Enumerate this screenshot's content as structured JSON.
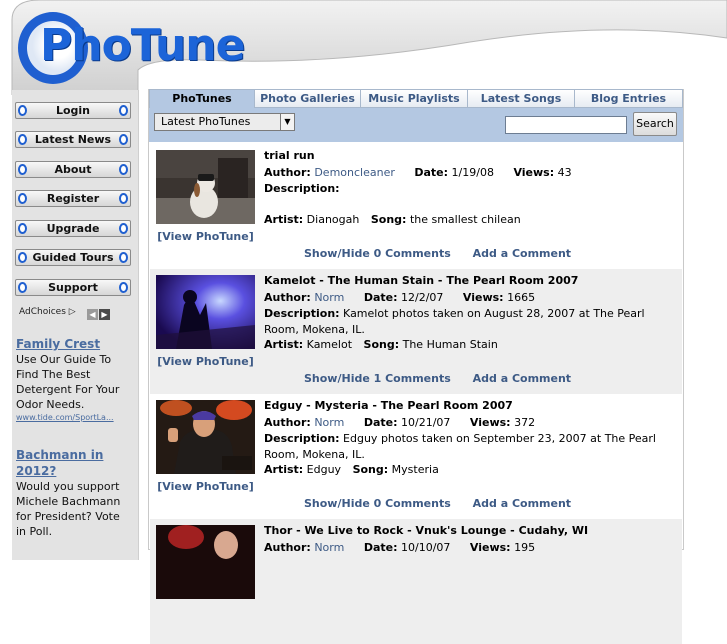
{
  "brand": {
    "logo_text": "PhoTune"
  },
  "nav": {
    "items": [
      "Login",
      "Latest News",
      "About",
      "Register",
      "Upgrade",
      "Guided Tours",
      "Support"
    ]
  },
  "ads": {
    "adchoices_label": "AdChoices",
    "items": [
      {
        "title": "Family Crest",
        "body": "Use Our Guide To Find The Best Detergent For Your Odor Needs.",
        "url": "www.tide.com/SportLa..."
      },
      {
        "title": "Bachmann in 2012?",
        "body": "Would you support Michele Bachmann for President? Vote in Poll.",
        "url": ""
      }
    ]
  },
  "tabs": [
    {
      "label": "PhoTunes",
      "active": true
    },
    {
      "label": "Photo Galleries",
      "active": false
    },
    {
      "label": "Music Playlists",
      "active": false
    },
    {
      "label": "Latest Songs",
      "active": false
    },
    {
      "label": "Blog Entries",
      "active": false
    }
  ],
  "toolbar": {
    "select_value": "Latest PhoTunes",
    "search_value": "",
    "search_button": "Search"
  },
  "labels": {
    "author": "Author:",
    "date": "Date:",
    "views": "Views:",
    "description": "Description:",
    "artist": "Artist:",
    "song": "Song:",
    "view_photune": "[View PhoTune]",
    "add_comment": "Add a Comment"
  },
  "entries": [
    {
      "title": "trial run",
      "author": "Demoncleaner",
      "date": "1/19/08",
      "views": "43",
      "description": "",
      "artist": "Dianogah",
      "song": "the smallest chilean",
      "comments": "Show/Hide 0 Comments"
    },
    {
      "title": "Kamelot - The Human Stain - The Pearl Room 2007",
      "author": "Norm",
      "date": "12/2/07",
      "views": "1665",
      "description": "Kamelot photos taken on August 28, 2007 at The Pearl Room, Mokena, IL.",
      "artist": "Kamelot",
      "song": "The Human Stain",
      "comments": "Show/Hide 1 Comments"
    },
    {
      "title": "Edguy - Mysteria - The Pearl Room 2007",
      "author": "Norm",
      "date": "10/21/07",
      "views": "372",
      "description": "Edguy photos taken on September 23, 2007 at The Pearl Room, Mokena, IL.",
      "artist": "Edguy",
      "song": "Mysteria",
      "comments": "Show/Hide 0 Comments"
    },
    {
      "title": "Thor - We Live to Rock - Vnuk's Lounge - Cudahy, WI",
      "author": "Norm",
      "date": "10/10/07",
      "views": "195",
      "description": "",
      "artist": "",
      "song": "",
      "comments": ""
    }
  ]
}
